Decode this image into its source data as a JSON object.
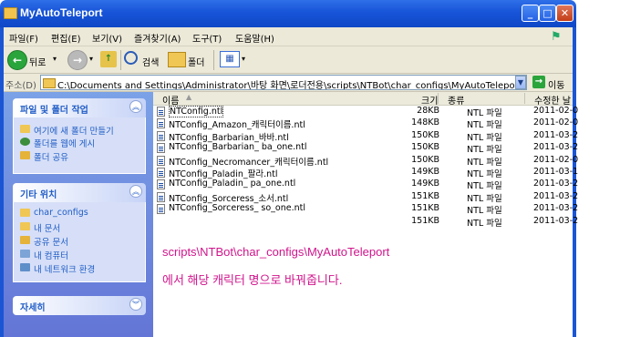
{
  "window": {
    "title": "MyAutoTeleport"
  },
  "menu": [
    "파일(F)",
    "편집(E)",
    "보기(V)",
    "즐겨찾기(A)",
    "도구(T)",
    "도움말(H)"
  ],
  "toolbar": {
    "back_label": "뒤로",
    "search_label": "검색",
    "folders_label": "폴더"
  },
  "address": {
    "label": "주소(D)",
    "path": "C:\\Documents and Settings\\Administrator\\바탕 화면\\로더전용\\scripts\\NTBot\\char_configs\\MyAutoTelepo",
    "go_label": "이동"
  },
  "taskpane": {
    "file_tasks": {
      "title": "파일 및 폴더 작업",
      "items": [
        "여기에 새 폴더 만들기",
        "폴더를 웹에 게시",
        "폴더 공유"
      ]
    },
    "other_places": {
      "title": "기타 위치",
      "items": [
        "char_configs",
        "내 문서",
        "공유 문서",
        "내 컴퓨터",
        "내 네트워크 환경"
      ]
    },
    "details": {
      "title": "자세히"
    }
  },
  "columns": {
    "name": "이름",
    "size": "크기",
    "type": "종류",
    "modified": "수정한 날"
  },
  "files": [
    {
      "name": "NTConfig.ntl",
      "size": "28KB",
      "type": "NTL 파일",
      "date": "2011-02-0"
    },
    {
      "name": "NTConfig_Amazon_캐릭터이름.ntl",
      "size": "148KB",
      "type": "NTL 파일",
      "date": "2011-02-0"
    },
    {
      "name": "NTConfig_Barbarian_바바.ntl",
      "size": "150KB",
      "type": "NTL 파일",
      "date": "2011-03-2"
    },
    {
      "name": "NTConfig_Barbarian_    ba_one.ntl",
      "size": "150KB",
      "type": "NTL 파일",
      "date": "2011-03-2"
    },
    {
      "name": "NTConfig_Necromancer_캐릭터이름.ntl",
      "size": "150KB",
      "type": "NTL 파일",
      "date": "2011-02-0"
    },
    {
      "name": "NTConfig_Paladin_팔라.ntl",
      "size": "149KB",
      "type": "NTL 파일",
      "date": "2011-03-1"
    },
    {
      "name": "NTConfig_Paladin_    pa_one.ntl",
      "size": "149KB",
      "type": "NTL 파일",
      "date": "2011-03-2"
    },
    {
      "name": "NTConfig_Sorceress_소서.ntl",
      "size": "151KB",
      "type": "NTL 파일",
      "date": "2011-03-2"
    },
    {
      "name": "NTConfig_Sorceress_    so_one.ntl",
      "size": "151KB",
      "type": "NTL 파일",
      "date": "2011-03-2"
    },
    {
      "name": "",
      "size": "151KB",
      "type": "NTL 파일",
      "date": "2011-03-2"
    }
  ],
  "annotation": {
    "line1": "scripts\\NTBot\\char_configs\\MyAutoTeleport",
    "line2": "에서 해당 캐릭터 명으로 바꿔줍니다."
  },
  "colors": {
    "titlebar": "#1754d8",
    "taskpane": "#6375d6",
    "annotation": "#d0148c"
  }
}
